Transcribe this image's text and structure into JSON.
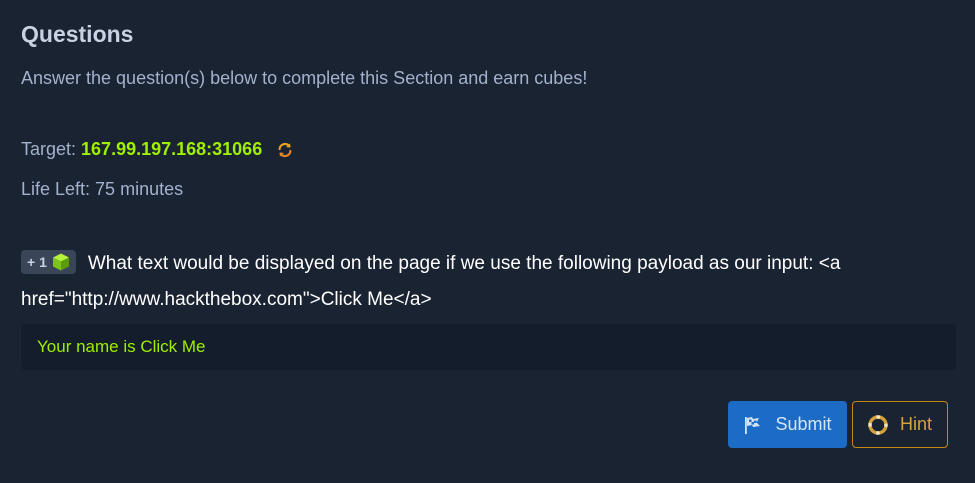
{
  "section": {
    "title": "Questions",
    "subtitle": "Answer the question(s) below to complete this Section and earn cubes!"
  },
  "target": {
    "label": "Target:",
    "value": "167.99.197.168:31066",
    "refresh_icon": "refresh-icon"
  },
  "life": {
    "text": "Life Left: 75 minutes"
  },
  "question": {
    "badge": "+ 1",
    "badge_icon": "cube-icon",
    "text": "What text would be displayed on the page if we use the following payload as our input: <a href=\"http://www.hackthebox.com\">Click Me</a>"
  },
  "answer": {
    "value": "Your name is Click Me"
  },
  "buttons": {
    "submit_label": "Submit",
    "hint_label": "Hint"
  },
  "colors": {
    "background": "#1a2332",
    "accent_green": "#9fef00",
    "submit_blue": "#1c6bc4",
    "hint_orange": "#c58a15"
  }
}
